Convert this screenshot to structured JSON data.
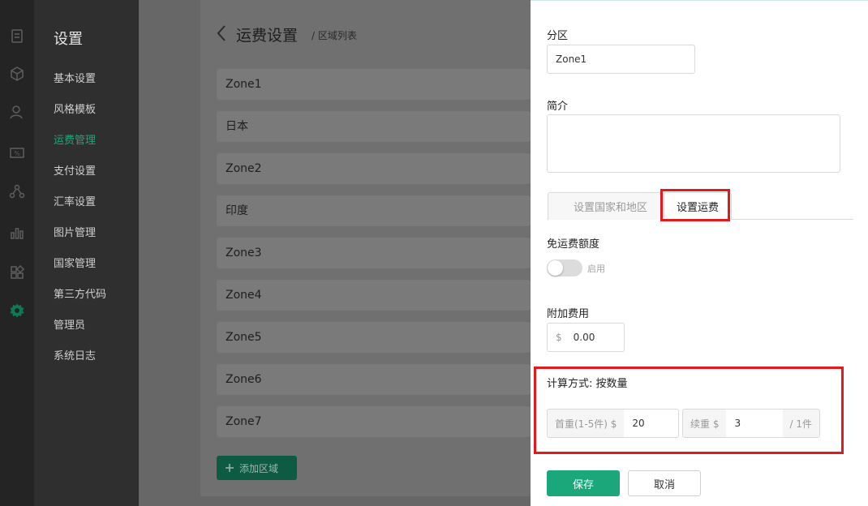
{
  "sidebar": {
    "title": "设置",
    "items": [
      {
        "label": "基本设置",
        "active": false
      },
      {
        "label": "风格模板",
        "active": false
      },
      {
        "label": "运费管理",
        "active": true
      },
      {
        "label": "支付设置",
        "active": false
      },
      {
        "label": "汇率设置",
        "active": false
      },
      {
        "label": "图片管理",
        "active": false
      },
      {
        "label": "国家管理",
        "active": false
      },
      {
        "label": "第三方代码",
        "active": false
      },
      {
        "label": "管理员",
        "active": false
      },
      {
        "label": "系统日志",
        "active": false
      }
    ]
  },
  "rail_icons": [
    "clipboard-icon",
    "box-icon",
    "users-icon",
    "coupon-icon",
    "network-icon",
    "chart-icon",
    "apps-icon",
    "gear-icon"
  ],
  "main": {
    "title": "运费设置",
    "breadcrumb": "/ 区域列表",
    "zones": [
      "Zone1",
      "日本",
      "Zone2",
      "印度",
      "Zone3",
      "Zone4",
      "Zone5",
      "Zone6",
      "Zone7"
    ],
    "add_zone_label": "添加区域"
  },
  "drawer": {
    "zone_label": "分区",
    "zone_value": "Zone1",
    "intro_label": "简介",
    "intro_value": "",
    "tabs": [
      {
        "label": "设置国家和地区",
        "active": false
      },
      {
        "label": "设置运费",
        "active": true
      }
    ],
    "free_shipping_label": "免运费额度",
    "free_shipping_toggle_label": "启用",
    "free_shipping_enabled": false,
    "surcharge_label": "附加费用",
    "surcharge_prefix": "$",
    "surcharge_value": "0.00",
    "calc_method_label": "计算方式: 按数量",
    "first_weight_prefix": "首重(1-5件) $",
    "first_weight_value": "20",
    "continue_prefix": "续重 $",
    "continue_value": "3",
    "continue_suffix": "/ 1件",
    "save_label": "保存",
    "cancel_label": "取消"
  },
  "colors": {
    "accent": "#1aa87a",
    "highlight": "#e3191b",
    "sidebar_bg": "#2f2f2f",
    "rail_bg": "#242424"
  }
}
